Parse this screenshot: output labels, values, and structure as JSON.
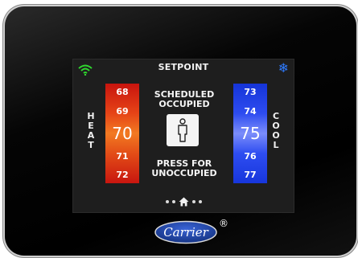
{
  "screen": {
    "title": "SETPOINT",
    "heat_label": [
      "H",
      "E",
      "A",
      "T"
    ],
    "cool_label": [
      "C",
      "O",
      "O",
      "L"
    ],
    "heat_temps": [
      "68",
      "69",
      "70",
      "71",
      "72"
    ],
    "cool_temps": [
      "73",
      "74",
      "75",
      "76",
      "77"
    ],
    "status_lines": [
      "SCHEDULED",
      "OCCUPIED"
    ],
    "action_lines": [
      "PRESS FOR",
      "UNOCCUPIED"
    ],
    "page_indicator": {
      "dots_before": 2,
      "dots_after": 2,
      "active": "home"
    }
  },
  "brand": {
    "name": "Carrier",
    "registered": "®"
  },
  "colors": {
    "heat": "#e64417",
    "cool": "#2d4cf0",
    "wifi": "#2fd62f",
    "snow": "#2e7bff",
    "logo_blue": "#1b3ea6"
  },
  "icons": {
    "wifi": "wifi-icon",
    "snow": "snowflake-icon",
    "person": "person-icon",
    "home": "home-icon"
  }
}
